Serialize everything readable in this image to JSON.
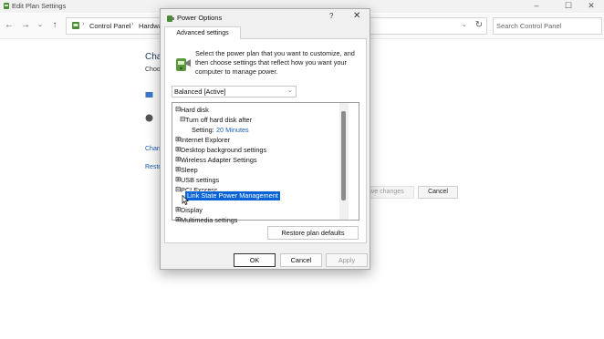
{
  "background_window": {
    "title": "Edit Plan Settings",
    "controls": {
      "minimize": "–",
      "maximize": "☐",
      "close": "✕"
    },
    "nav": {
      "back": "←",
      "forward": "→",
      "dropdown": "⌄",
      "up": "↑"
    },
    "address": {
      "segment1": "Control Panel",
      "segment2": "Hardwa",
      "chevron": "›",
      "dropdown": "⌄"
    },
    "refresh_label": "↻",
    "search": {
      "placeholder": "Search Control Panel"
    },
    "page_title": "Cha",
    "page_subtitle": "Choo",
    "link1": "Chan",
    "link2": "Resto",
    "save_button": "ave changes",
    "cancel_button": "Cancel"
  },
  "dialog": {
    "title": "Power Options",
    "help": "?",
    "close": "✕",
    "tab": "Advanced settings",
    "intro": "Select the power plan that you want to customize, and then choose settings that reflect how you want your computer to manage power.",
    "plan_select": {
      "value": "Balanced [Active]",
      "chevron": "⌄"
    },
    "tree": {
      "expanded_mark": "⊟",
      "collapsed_mark": "⊞",
      "items": [
        {
          "label": "Hard disk",
          "expanded": true
        },
        {
          "label": "Turn off hard disk after",
          "expanded": true
        },
        {
          "label": "Setting:",
          "value": "20 Minutes"
        },
        {
          "label": "Internet Explorer"
        },
        {
          "label": "Desktop background settings"
        },
        {
          "label": "Wireless Adapter Settings"
        },
        {
          "label": "Sleep"
        },
        {
          "label": "USB settings"
        },
        {
          "label": "PCI Express",
          "expanded": true
        },
        {
          "label": "Link State Power Management",
          "selected": true
        },
        {
          "label": "Display"
        },
        {
          "label": "Multimedia settings"
        }
      ]
    },
    "restore_button": "Restore plan defaults",
    "ok_button": "OK",
    "cancel_button": "Cancel",
    "apply_button": "Apply"
  },
  "colors": {
    "selection": "#0a64d8",
    "link": "#1a5fb4",
    "setting_value": "#1a5fb4",
    "scrollbar_thumb": "#8c8c8c"
  },
  "icons": [
    "power-plan-icon",
    "control-panel-icon",
    "mouse-cursor-icon",
    "refresh-icon",
    "back-arrow-icon",
    "forward-arrow-icon",
    "up-arrow-icon"
  ]
}
